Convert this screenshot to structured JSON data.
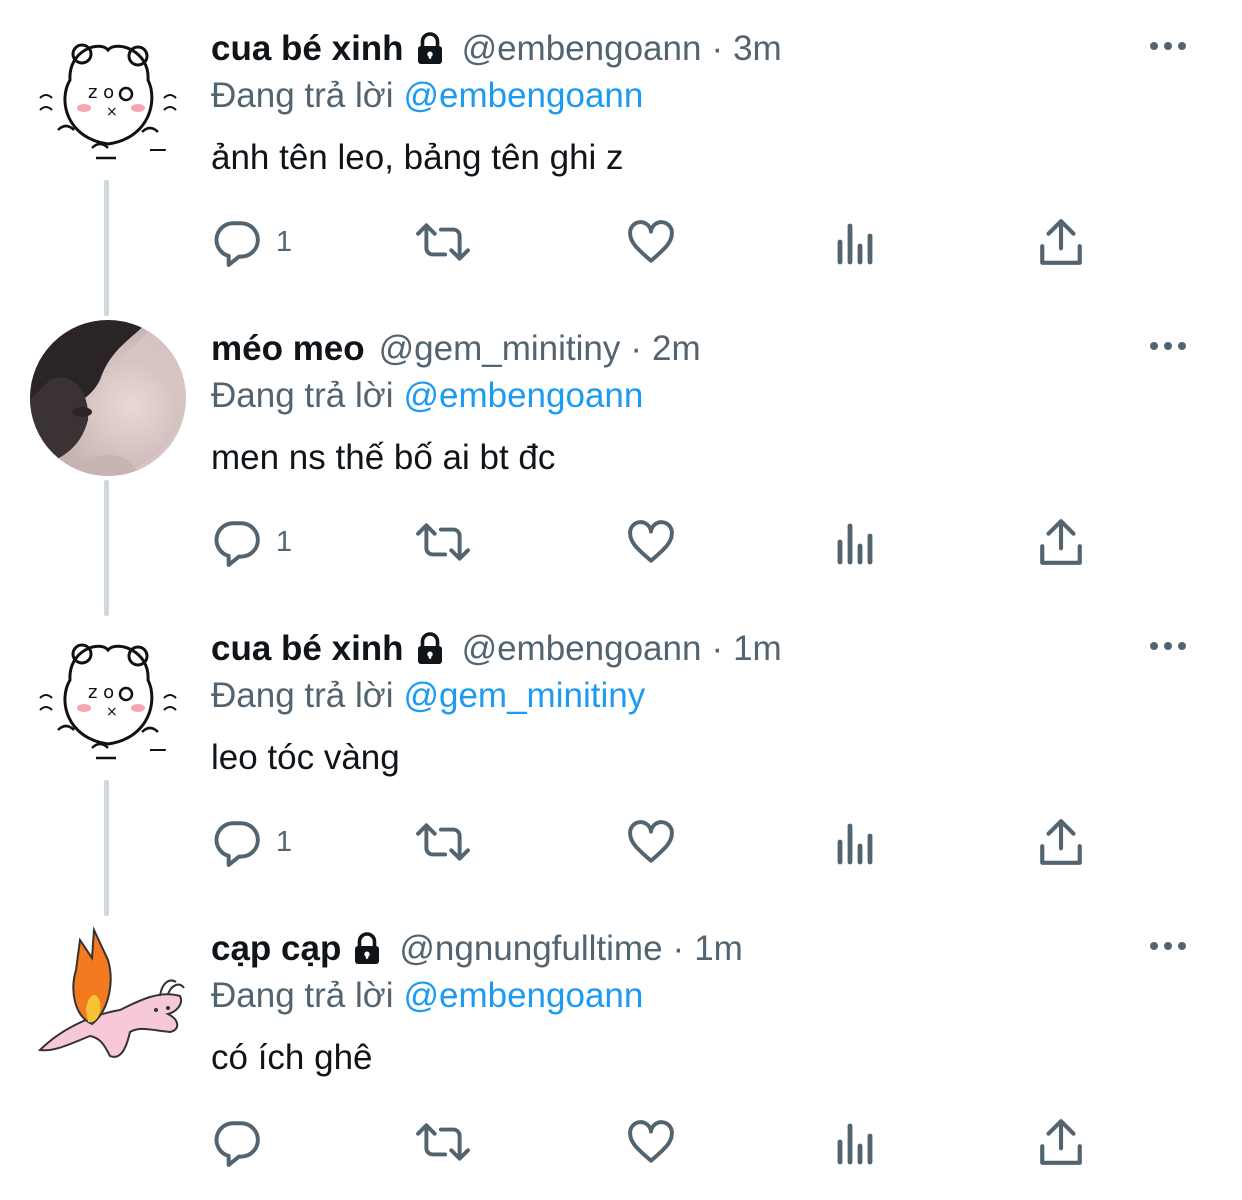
{
  "tweets": [
    {
      "display_name": "cua bé xinh",
      "locked": true,
      "handle": "@embengoann",
      "separator": "·",
      "time": "3m",
      "reply_label": "Đang trả lời",
      "reply_to": "@embengoann",
      "text": "ảnh tên leo, bảng tên ghi z",
      "reply_count": "1",
      "avatar": "doodle-bear-avatar"
    },
    {
      "display_name": "méo meo",
      "locked": false,
      "handle": "@gem_minitiny",
      "separator": "·",
      "time": "2m",
      "reply_label": "Đang trả lời",
      "reply_to": "@embengoann",
      "text": "men ns thế bố ai bt đc",
      "reply_count": "1",
      "avatar": "photo-avatar"
    },
    {
      "display_name": "cua bé xinh",
      "locked": true,
      "handle": "@embengoann",
      "separator": "·",
      "time": "1m",
      "reply_label": "Đang trả lời",
      "reply_to": "@gem_minitiny",
      "text": "leo tóc vàng",
      "reply_count": "1",
      "avatar": "doodle-bear-avatar"
    },
    {
      "display_name": "cạp cạp",
      "locked": true,
      "handle": "@ngnungfulltime",
      "separator": "·",
      "time": "1m",
      "reply_label": "Đang trả lời",
      "reply_to": "@embengoann",
      "text": "có ích ghê",
      "reply_count": "",
      "avatar": "pink-rabbit-avatar"
    }
  ],
  "icons": {
    "reply": "reply-icon",
    "retweet": "retweet-icon",
    "like": "like-icon",
    "views": "views-icon",
    "share": "share-icon",
    "more": "more-icon",
    "lock": "lock-icon"
  },
  "colors": {
    "text_primary": "#0f1419",
    "text_secondary": "#536471",
    "link": "#1d9bf0",
    "thread_line": "#cfd9de"
  }
}
